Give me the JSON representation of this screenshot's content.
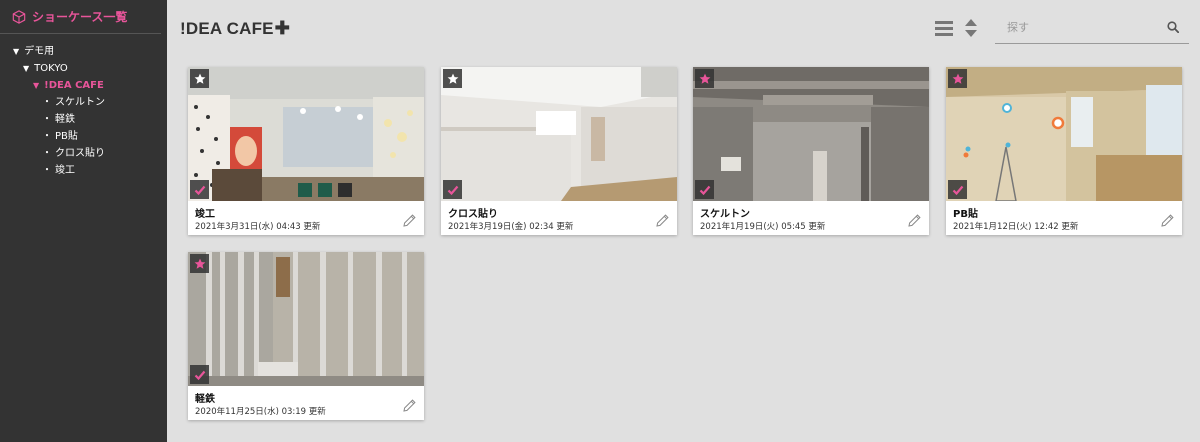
{
  "sidebar": {
    "title": "ショーケース一覧",
    "tree": {
      "root": "デモ用",
      "group": "TOKYO",
      "project": "!DEA CAFE",
      "items": [
        "スケルトン",
        "軽鉄",
        "PB貼",
        "クロス貼り",
        "竣工"
      ]
    }
  },
  "header": {
    "brand": "!DEA CAFE",
    "brand_suffix": "✚",
    "search_placeholder": "探す"
  },
  "cards": [
    {
      "title": "竣工",
      "date": "2021年3月31日(水) 04:43 更新",
      "star_color": "#ffffff",
      "check_color": "#e8559a"
    },
    {
      "title": "クロス貼り",
      "date": "2021年3月19日(金) 02:34 更新",
      "star_color": "#ffffff",
      "check_color": "#e8559a"
    },
    {
      "title": "スケルトン",
      "date": "2021年1月19日(火) 05:45 更新",
      "star_color": "#e8559a",
      "check_color": "#e8559a"
    },
    {
      "title": "PB貼",
      "date": "2021年1月12日(火) 12:42 更新",
      "star_color": "#e8559a",
      "check_color": "#e8559a"
    },
    {
      "title": "軽鉄",
      "date": "2020年11月25日(水) 03:19 更新",
      "star_color": "#e8559a",
      "check_color": "#e8559a"
    }
  ],
  "colors": {
    "accent": "#e8559a",
    "sidebar_bg": "#333333",
    "page_bg": "#e0e0e0"
  },
  "icons": [
    "cube-icon",
    "list-view-icon",
    "sort-icon",
    "search-icon",
    "star-icon",
    "check-icon",
    "pencil-icon"
  ]
}
